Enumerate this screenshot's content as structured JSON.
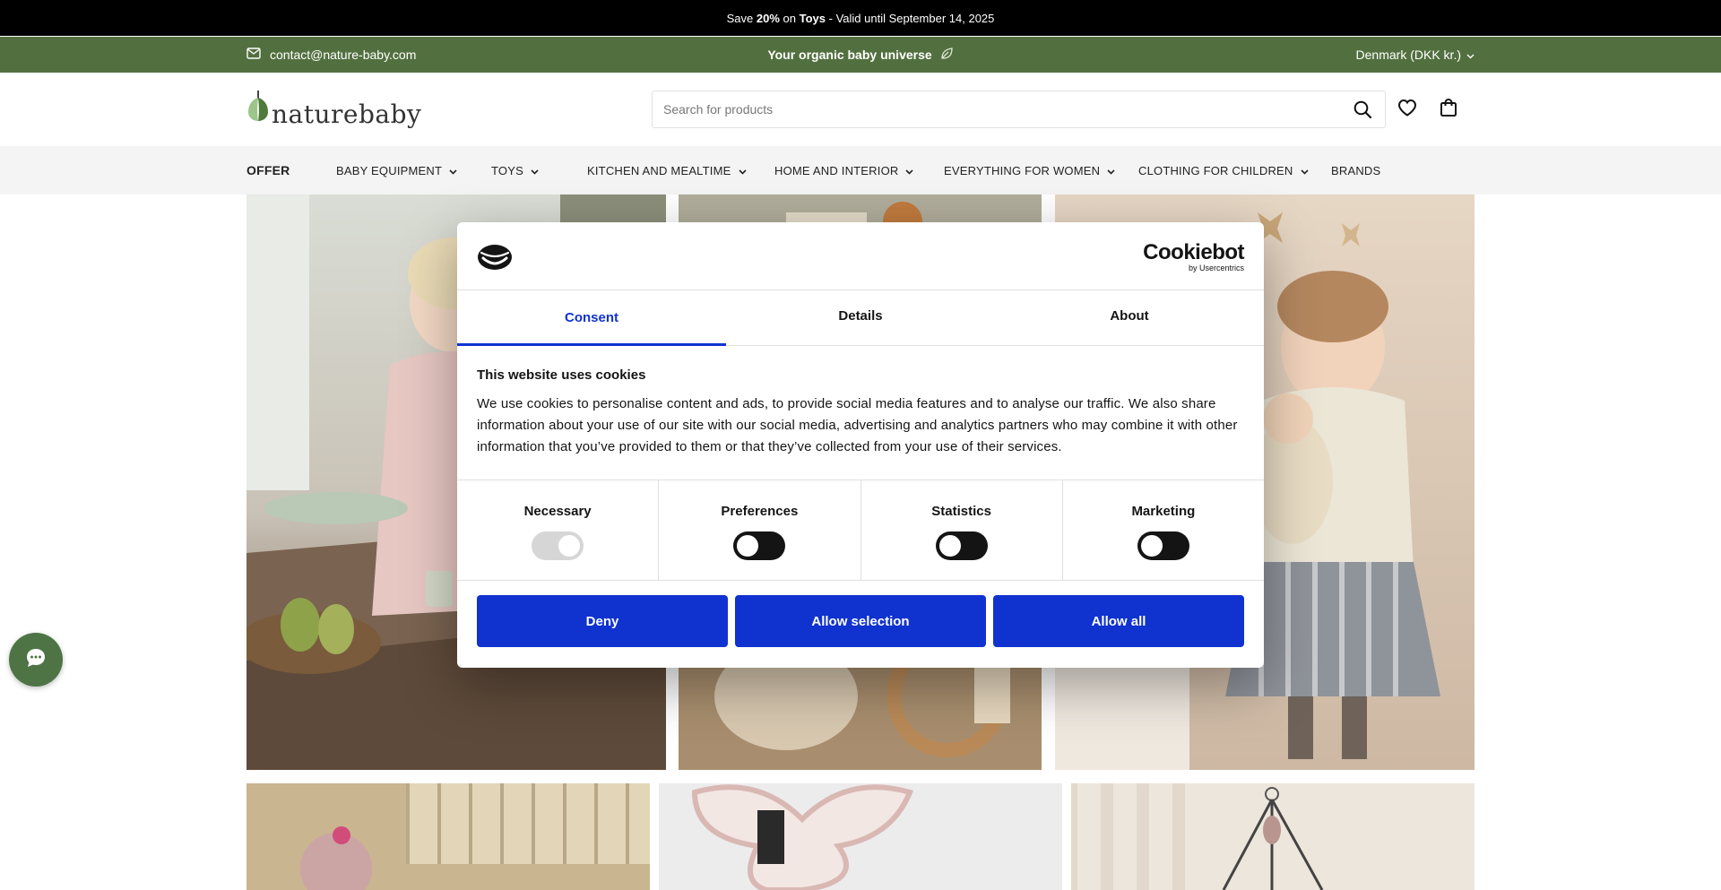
{
  "announcement": {
    "prefix": "Save ",
    "discount": "20%",
    "middle": " on ",
    "category": "Toys",
    "suffix": " - Valid until September 14, 2025"
  },
  "topbar": {
    "email": "contact@nature-baby.com",
    "tagline": "Your organic baby universe",
    "country": "Denmark (DKK kr.)"
  },
  "header": {
    "logo_text": "naturebaby",
    "search_placeholder": "Search for products"
  },
  "nav": {
    "items": [
      {
        "label": "OFFER"
      },
      {
        "label": "BABY EQUIPMENT"
      },
      {
        "label": "TOYS"
      },
      {
        "label": "KITCHEN AND MEALTIME"
      },
      {
        "label": "HOME AND INTERIOR"
      },
      {
        "label": "EVERYTHING FOR WOMEN"
      },
      {
        "label": "CLOTHING FOR CHILDREN"
      },
      {
        "label": "BRANDS"
      }
    ]
  },
  "cookie": {
    "brand": "Cookiebot",
    "brand_sub": "by Usercentrics",
    "tabs": [
      "Consent",
      "Details",
      "About"
    ],
    "title": "This website uses cookies",
    "body": "We use cookies to personalise content and ads, to provide social media features and to analyse our traffic. We also share information about your use of our site with our social media, advertising and analytics partners who may combine it with other information that you’ve provided to them or that they’ve collected from your use of their services.",
    "categories": [
      {
        "label": "Necessary",
        "state": "on-disabled"
      },
      {
        "label": "Preferences",
        "state": "off"
      },
      {
        "label": "Statistics",
        "state": "off"
      },
      {
        "label": "Marketing",
        "state": "off"
      }
    ],
    "buttons": {
      "deny": "Deny",
      "selection": "Allow selection",
      "all": "Allow all"
    }
  },
  "colors": {
    "green": "#52703f",
    "cookie_blue": "#1032cf",
    "announce_bg": "#000000"
  }
}
